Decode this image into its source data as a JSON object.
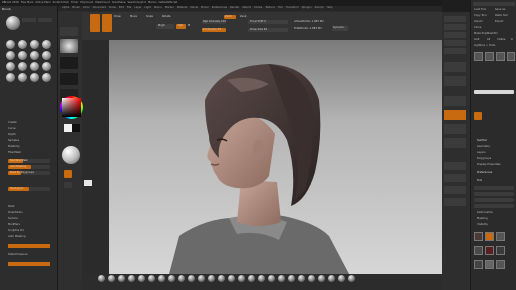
{
  "app": {
    "title": "ZBrush"
  },
  "menubar": [
    "ZBrush 2018",
    "Free Mem",
    "Active Mem",
    "Scratch Disk",
    "Timer",
    "PolyCount",
    "MeshCount",
    "QuickSave",
    "See-through 0",
    "Menus",
    "DefaultZScript"
  ],
  "menus": [
    "Alpha",
    "Brush",
    "Color",
    "Document",
    "Draw",
    "Edit",
    "File",
    "Layer",
    "Light",
    "Macro",
    "Marker",
    "Material",
    "Movie",
    "Picker",
    "Preferences",
    "Render",
    "Stencil",
    "Stroke",
    "Texture",
    "Tool",
    "Transform",
    "Zplugin",
    "Zscript",
    "Help"
  ],
  "left_panel": {
    "header": "Brush",
    "items": [
      "Create",
      "Curve",
      "Depth",
      "Samples",
      "Elasticity",
      "FiberMesh",
      "Twist",
      "Orientation",
      "Surface",
      "Modifiers",
      "Sculptris Pro",
      "Auto Masking",
      "Tablet Pressure"
    ],
    "sliders": [
      {
        "label": "Backface Mask",
        "level": 0.35
      },
      {
        "label": "Auto Masking",
        "level": 0.55
      },
      {
        "label": "Mask By Polygroups",
        "level": 0.3
      },
      {
        "label": "Topological",
        "level": 0.5
      }
    ]
  },
  "toolbar": {
    "draw": "Draw",
    "move": "Move",
    "scale": "Scale",
    "rotate": "Rotate",
    "mrgb": "Mrgb",
    "rgb": "Rgb",
    "m": "M",
    "zadd": "Zadd",
    "zsub": "Zsub",
    "focal_shift": "Focal Shift 0",
    "draw_size": "Draw Size 64",
    "rgb_intensity": "Rgb Intensity 100",
    "z_intensity": "Z Intensity 25",
    "active_points": "ActivePoints: 1.083 Mil",
    "total_points": "TotalPoints: 1.083 Mil",
    "dynamic": "Dynamic"
  },
  "right_panel": {
    "sections": [
      "SubTool",
      "Geometry",
      "Layers",
      "Polygroups",
      "Display Properties",
      "Preferences",
      "Tool",
      "Deformation",
      "Masking",
      "Visibility"
    ],
    "labels": [
      "Load Tool",
      "Save As",
      "Copy Tool",
      "Paste Tool",
      "Import",
      "Export",
      "Clone",
      "Make PolyMesh3D",
      "GoZ",
      "All",
      "Visible",
      "R",
      "Lightbox > Tools"
    ]
  },
  "colors": {
    "accent": "#c86a10",
    "panel": "#2b2b2b",
    "canvas_top": "#7a7a7a",
    "canvas_bottom": "#d6d6d6"
  }
}
